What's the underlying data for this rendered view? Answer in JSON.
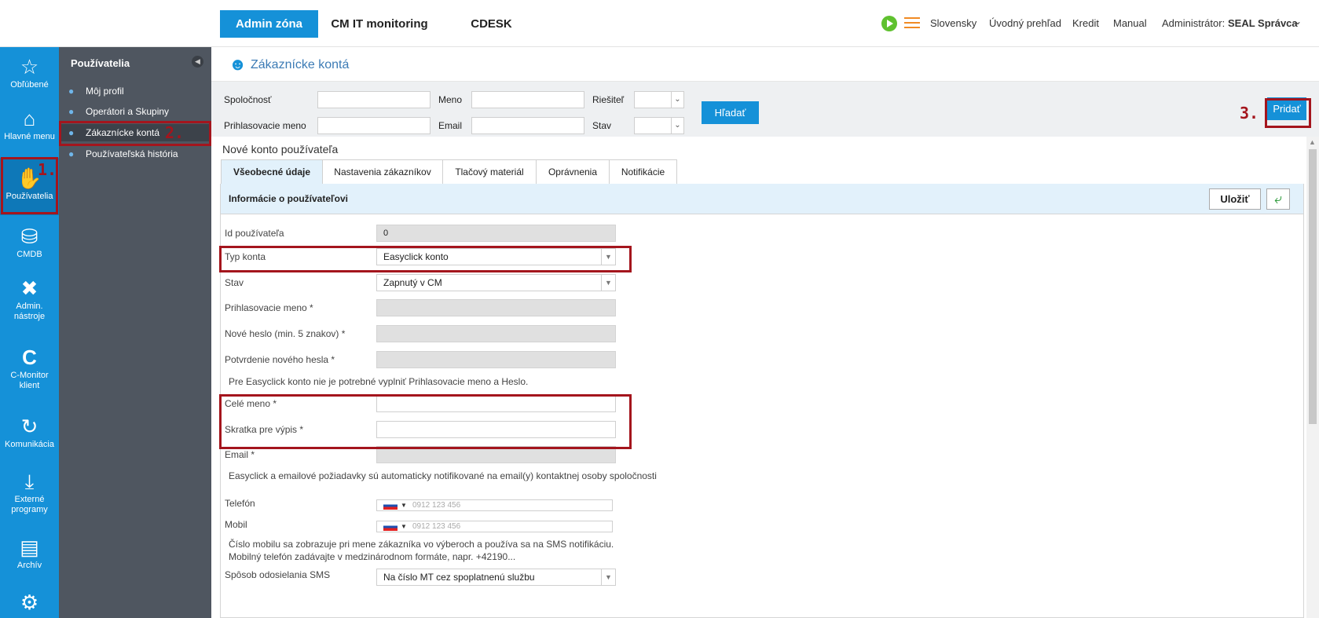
{
  "topbar": {
    "nav": [
      "Admin zóna",
      "CM IT monitoring",
      "CDESK"
    ],
    "right_links": [
      "Slovensky",
      "Úvodný prehľad",
      "Kredit",
      "Manual"
    ],
    "admin_label": "Administrátor:",
    "admin_name": "SEAL Správca"
  },
  "sidebar": {
    "items": [
      {
        "label": "Obľúbené",
        "icon": "star-icon"
      },
      {
        "label": "Hlavné menu",
        "icon": "home-icon"
      },
      {
        "label": "Používatelia",
        "icon": "users-icon"
      },
      {
        "label": "CMDB",
        "icon": "database-icon"
      },
      {
        "label": "Admin. nástroje",
        "icon": "tools-icon"
      },
      {
        "label": "C-Monitor klient",
        "icon": "c-icon"
      },
      {
        "label": "Komunikácia",
        "icon": "sync-icon"
      },
      {
        "label": "Externé programy",
        "icon": "download-icon"
      },
      {
        "label": "Archív",
        "icon": "archive-icon"
      }
    ]
  },
  "subnav": {
    "title": "Používatelia",
    "items": [
      "Môj profil",
      "Operátori a Skupiny",
      "Zákaznícke kontá",
      "Používateľská história"
    ]
  },
  "page": {
    "title": "Zákaznícke kontá"
  },
  "filter": {
    "company_label": "Spoločnosť",
    "name_label": "Meno",
    "solver_label": "Riešiteľ",
    "login_label": "Prihlasovacie meno",
    "email_label": "Email",
    "status_label": "Stav",
    "search_button": "Hľadať",
    "add_button": "Pridať"
  },
  "form": {
    "title": "Nové konto používateľa",
    "tabs": [
      "Všeobecné údaje",
      "Nastavenia zákazníkov",
      "Tlačový materiál",
      "Oprávnenia",
      "Notifikácie"
    ],
    "section_title": "Informácie o používateľovi",
    "save_button": "Uložiť",
    "fields": {
      "user_id_label": "Id používateľa",
      "user_id_value": "0",
      "account_type_label": "Typ konta",
      "account_type_value": "Easyclick konto",
      "status_label": "Stav",
      "status_value": "Zapnutý v CM",
      "login_label": "Prihlasovacie meno *",
      "new_password_label": "Nové heslo (min. 5 znakov) *",
      "confirm_password_label": "Potvrdenie nového hesla *",
      "easyclick_note": "Pre Easyclick konto nie je potrebné vyplniť Prihlasovacie meno a Heslo.",
      "full_name_label": "Celé meno *",
      "short_name_label": "Skratka pre výpis *",
      "email_label": "Email *",
      "email_note": "Easyclick a emailové požiadavky sú automaticky notifikované na email(y) kontaktnej osoby spoločnosti",
      "phone_label": "Telefón",
      "phone_placeholder": "0912 123 456",
      "mobile_label": "Mobil",
      "mobile_placeholder": "0912 123 456",
      "mobile_note_1": "Číslo mobilu sa zobrazuje pri mene zákazníka vo výberoch a používa sa na SMS notifikáciu.",
      "mobile_note_2": "Mobilný telefón zadávajte v medzinárodnom formáte, napr. +42190...",
      "sms_label": "Spôsob odosielania SMS",
      "sms_value": "Na číslo MT cez spoplatnenú službu"
    }
  },
  "annotations": {
    "step1": "1.",
    "step2": "2.",
    "step3": "3."
  },
  "colors": {
    "accent": "#1591d8",
    "highlight": "#a4151d",
    "subnav_bg": "#4f5660"
  }
}
